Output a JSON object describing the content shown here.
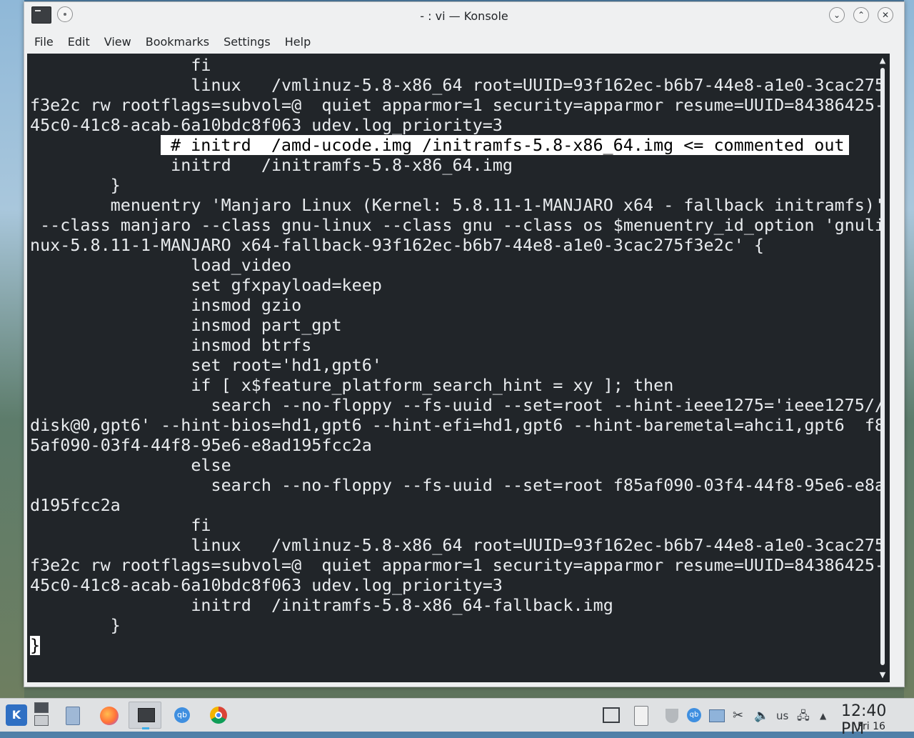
{
  "window": {
    "title": "- : vi — Konsole",
    "minimize_glyph": "⌄",
    "maximize_glyph": "⌃",
    "close_glyph": "✕"
  },
  "menubar": {
    "items": [
      "File",
      "Edit",
      "View",
      "Bookmarks",
      "Settings",
      "Help"
    ]
  },
  "terminal": {
    "lines": [
      "                fi",
      "                linux   /vmlinuz-5.8-x86_64 root=UUID=93f162ec-b6b7-44e8-a1e0-3cac275",
      "f3e2c rw rootflags=subvol=@  quiet apparmor=1 security=apparmor resume=UUID=84386425-",
      "45c0-41c8-acab-6a10bdc8f063 udev.log_priority=3",
      "",
      "              initrd   /initramfs-5.8-x86_64.img",
      "        }",
      "        menuentry 'Manjaro Linux (Kernel: 5.8.11-1-MANJARO x64 - fallback initramfs)'",
      " --class manjaro --class gnu-linux --class gnu --class os $menuentry_id_option 'gnuli",
      "nux-5.8.11-1-MANJARO x64-fallback-93f162ec-b6b7-44e8-a1e0-3cac275f3e2c' {",
      "                load_video",
      "                set gfxpayload=keep",
      "                insmod gzio",
      "                insmod part_gpt",
      "                insmod btrfs",
      "                set root='hd1,gpt6'",
      "                if [ x$feature_platform_search_hint = xy ]; then",
      "                  search --no-floppy --fs-uuid --set=root --hint-ieee1275='ieee1275//",
      "disk@0,gpt6' --hint-bios=hd1,gpt6 --hint-efi=hd1,gpt6 --hint-baremetal=ahci1,gpt6  f8",
      "5af090-03f4-44f8-95e6-e8ad195fcc2a",
      "                else",
      "                  search --no-floppy --fs-uuid --set=root f85af090-03f4-44f8-95e6-e8a",
      "d195fcc2a",
      "                fi",
      "                linux   /vmlinuz-5.8-x86_64 root=UUID=93f162ec-b6b7-44e8-a1e0-3cac275",
      "f3e2c rw rootflags=subvol=@  quiet apparmor=1 security=apparmor resume=UUID=84386425-",
      "45c0-41c8-acab-6a10bdc8f063 udev.log_priority=3",
      "                initrd  /initramfs-5.8-x86_64-fallback.img",
      "        }"
    ],
    "highlighted_line": "# initrd  /amd-ucode.img /initramfs-5.8-x86_64.img <= commented out",
    "cursor_char": "}",
    "colors": {
      "background": "#212529",
      "foreground": "#e9ecef",
      "highlight_bg": "#ffffff",
      "highlight_fg": "#000000"
    }
  },
  "taskbar": {
    "launcher_label": "K",
    "qbittorrent_label": "qb",
    "keyboard_layout": "us",
    "clock_time": "12:40 PM",
    "clock_date": "Fri 16",
    "icons": [
      "kde-launcher-icon",
      "pager-icon",
      "file-manager-icon",
      "firefox-icon",
      "konsole-icon",
      "qbittorrent-icon",
      "chrome-icon",
      "show-desktop-icon",
      "clipboard-icon",
      "shield-icon",
      "qbittorrent-tray-icon",
      "screen-icon",
      "scissors-icon",
      "volume-icon",
      "network-icon",
      "tray-expand-icon"
    ]
  }
}
